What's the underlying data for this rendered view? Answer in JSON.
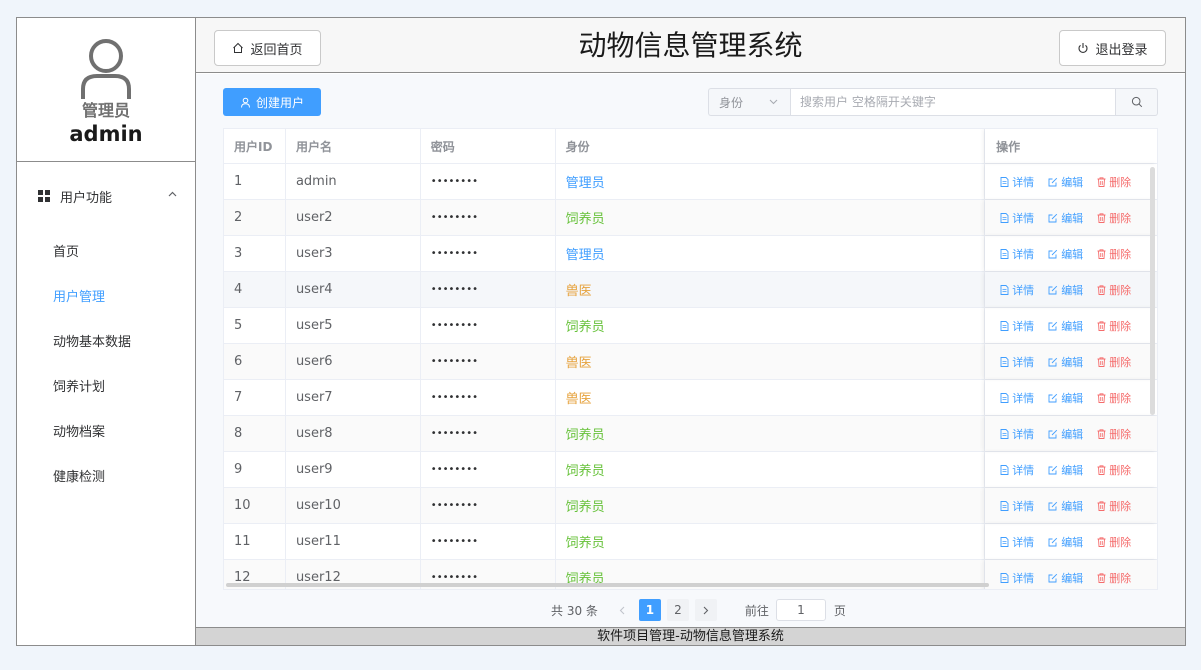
{
  "sidebar": {
    "role_label": "管理员",
    "username": "admin",
    "group_label": "用户功能",
    "items": [
      {
        "label": "首页"
      },
      {
        "label": "用户管理"
      },
      {
        "label": "动物基本数据"
      },
      {
        "label": "饲养计划"
      },
      {
        "label": "动物档案"
      },
      {
        "label": "健康检测"
      }
    ]
  },
  "header": {
    "home_label": "返回首页",
    "title": "动物信息管理系统",
    "logout_label": "退出登录"
  },
  "toolbar": {
    "create_label": "创建用户",
    "role_select_value": "身份",
    "search_placeholder": "搜索用户 空格隔开关键字"
  },
  "table": {
    "headers": {
      "id": "用户ID",
      "username": "用户名",
      "password": "密码",
      "role": "身份",
      "ops": "操作"
    },
    "op_labels": {
      "detail": "详情",
      "edit": "编辑",
      "delete": "删除"
    },
    "rows": [
      {
        "id": "1",
        "username": "admin",
        "password": "••••••••",
        "role": "管理员"
      },
      {
        "id": "2",
        "username": "user2",
        "password": "••••••••",
        "role": "饲养员"
      },
      {
        "id": "3",
        "username": "user3",
        "password": "••••••••",
        "role": "管理员"
      },
      {
        "id": "4",
        "username": "user4",
        "password": "••••••••",
        "role": "兽医"
      },
      {
        "id": "5",
        "username": "user5",
        "password": "••••••••",
        "role": "饲养员"
      },
      {
        "id": "6",
        "username": "user6",
        "password": "••••••••",
        "role": "兽医"
      },
      {
        "id": "7",
        "username": "user7",
        "password": "••••••••",
        "role": "兽医"
      },
      {
        "id": "8",
        "username": "user8",
        "password": "••••••••",
        "role": "饲养员"
      },
      {
        "id": "9",
        "username": "user9",
        "password": "••••••••",
        "role": "饲养员"
      },
      {
        "id": "10",
        "username": "user10",
        "password": "••••••••",
        "role": "饲养员"
      },
      {
        "id": "11",
        "username": "user11",
        "password": "••••••••",
        "role": "饲养员"
      },
      {
        "id": "12",
        "username": "user12",
        "password": "••••••••",
        "role": "饲养员"
      }
    ]
  },
  "pagination": {
    "total_text": "共 30 条",
    "pages": [
      "1",
      "2"
    ],
    "current": "1",
    "goto_label": "前往",
    "goto_value": "1",
    "page_suffix": "页"
  },
  "footer": {
    "text": "软件项目管理-动物信息管理系统"
  },
  "colors": {
    "accent": "#409eff",
    "role_admin": "#409eff",
    "role_keeper": "#67c23a",
    "role_vet": "#e6a23c",
    "danger": "#f56c6c"
  }
}
